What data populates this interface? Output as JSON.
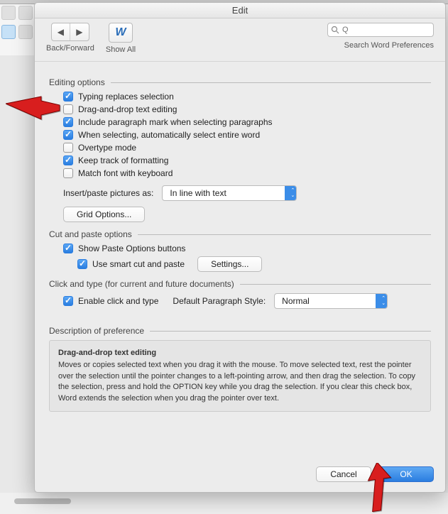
{
  "dialog": {
    "title": "Edit",
    "toolbar": {
      "back_forward_label": "Back/Forward",
      "show_all_label": "Show All",
      "search_placeholder": "",
      "search_icon_glyph": "Q",
      "search_caption": "Search Word Preferences"
    }
  },
  "sections": {
    "editing": {
      "title": "Editing options",
      "opts": [
        {
          "label": "Typing replaces selection",
          "checked": true
        },
        {
          "label": "Drag-and-drop text editing",
          "checked": false
        },
        {
          "label": "Include paragraph mark when selecting paragraphs",
          "checked": true
        },
        {
          "label": "When selecting, automatically select entire word",
          "checked": true
        },
        {
          "label": "Overtype mode",
          "checked": false
        },
        {
          "label": "Keep track of formatting",
          "checked": true
        },
        {
          "label": "Match font with keyboard",
          "checked": false
        }
      ],
      "insert_label": "Insert/paste pictures as:",
      "insert_value": "In line with text",
      "grid_button": "Grid Options..."
    },
    "cutpaste": {
      "title": "Cut and paste options",
      "opts": [
        {
          "label": "Show Paste Options buttons",
          "checked": true
        },
        {
          "label": "Use smart cut and paste",
          "checked": true
        }
      ],
      "settings_button": "Settings..."
    },
    "clicktype": {
      "title": "Click and type (for current and future documents)",
      "enable": {
        "label": "Enable click and type",
        "checked": true
      },
      "paragraph_label": "Default Paragraph Style:",
      "paragraph_value": "Normal"
    },
    "description": {
      "title": "Description of preference",
      "heading": "Drag-and-drop text editing",
      "body": "Moves or copies selected text when you drag it with the mouse. To move selected text, rest the pointer over the selection until the pointer changes to a left-pointing arrow, and then drag the selection. To copy the selection, press and hold the OPTION key while you drag the selection. If you clear this check box, Word extends the selection when you drag the pointer over text."
    }
  },
  "footer": {
    "cancel": "Cancel",
    "ok": "OK"
  }
}
